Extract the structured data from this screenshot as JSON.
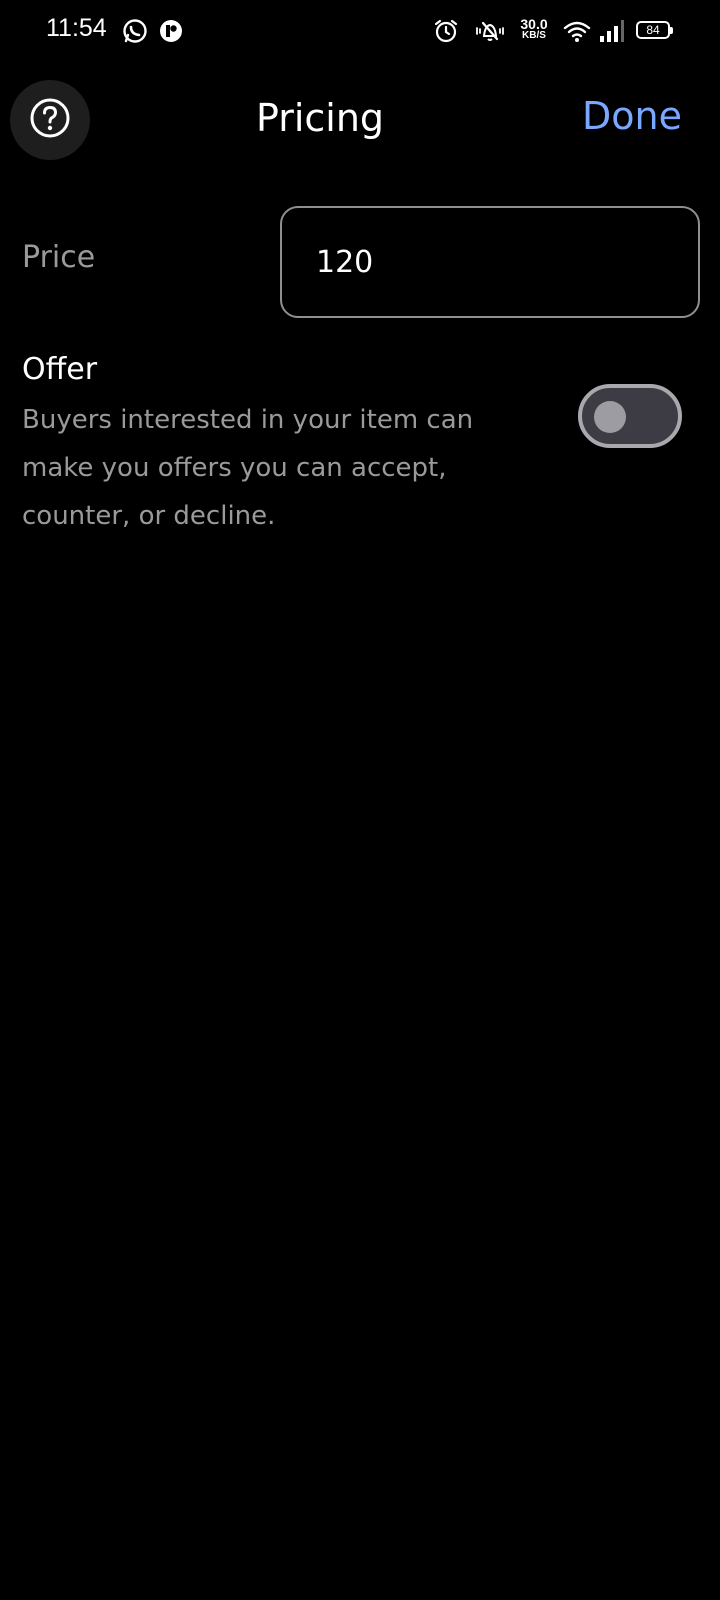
{
  "status_bar": {
    "time": "11:54",
    "net_speed_value": "30.0",
    "net_speed_unit": "KB/S",
    "battery_level": "84",
    "icons": [
      "whatsapp-icon",
      "app-notification-icon",
      "alarm-icon",
      "silent-bell-icon",
      "wifi-icon",
      "signal-icon",
      "battery-icon"
    ]
  },
  "header": {
    "title": "Pricing",
    "done_label": "Done",
    "help_icon": "question-circle-icon"
  },
  "price": {
    "label": "Price",
    "value": "120"
  },
  "offer": {
    "title": "Offer",
    "description": "Buyers interested in your item can make you offers you can accept, counter, or decline.",
    "toggle_on": false
  },
  "colors": {
    "background": "#000000",
    "accent": "#7aa7ff",
    "secondary_text": "#9a9a9a",
    "toggle_track": "#3d3c44"
  }
}
